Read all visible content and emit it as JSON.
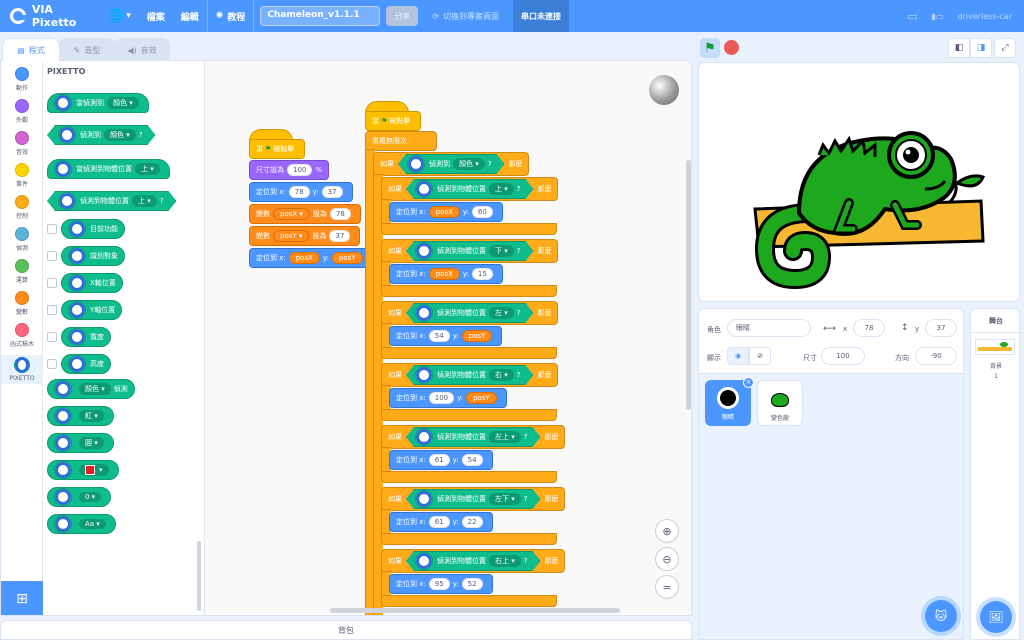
{
  "menubar": {
    "app_name": "VIA Pixetto",
    "file": "檔案",
    "edit": "編輯",
    "tutorials": "教程",
    "project_title": "Chameleon_v1.1.1",
    "share": "分享",
    "switch_page": "切換到專案頁面",
    "serial_status": "串口未連接",
    "device": "driverless-car"
  },
  "tabs": {
    "code": "程式",
    "costumes": "造型",
    "sounds": "音效"
  },
  "categories": [
    {
      "label": "動作",
      "color": "#4c97ff"
    },
    {
      "label": "外觀",
      "color": "#9966ff"
    },
    {
      "label": "音效",
      "color": "#cf63cf"
    },
    {
      "label": "事件",
      "color": "#ffd500"
    },
    {
      "label": "控制",
      "color": "#ffab19"
    },
    {
      "label": "偵測",
      "color": "#5cb1d6"
    },
    {
      "label": "運算",
      "color": "#59c059"
    },
    {
      "label": "變數",
      "color": "#ff8c1a"
    },
    {
      "label": "函式積木",
      "color": "#ff6680"
    },
    {
      "label": "PIXETTO",
      "color": "#ffffff"
    }
  ],
  "palette": {
    "title": "PIXETTO",
    "blocks": [
      {
        "text": "當偵測到",
        "dd": "顏色"
      },
      {
        "text": "偵測到",
        "dd": "顏色",
        "q": "?"
      },
      {
        "text": "當偵測到物體位置",
        "dd": "上"
      },
      {
        "text": "偵測到物體位置",
        "dd": "上",
        "q": "?"
      },
      {
        "text": "目前功能"
      },
      {
        "text": "識別對象"
      },
      {
        "text": "X軸位置"
      },
      {
        "text": "Y軸位置"
      },
      {
        "text": "寬度"
      },
      {
        "text": "高度"
      },
      {
        "dd": "顏色",
        "text": "偵測"
      },
      {
        "dd": "紅"
      },
      {
        "dd": "圓"
      },
      {
        "dd": ""
      },
      {
        "dd": "0"
      },
      {
        "dd": "Aa"
      }
    ]
  },
  "script1": {
    "hat": "當",
    "hat2": "被點擊",
    "size_label": "尺寸設為",
    "size_val": "100",
    "size_unit": "%",
    "goto_label": "定位到 x:",
    "goto_x": "78",
    "y_label": "y:",
    "goto_y": "37",
    "var_label": "變數",
    "set_to": "設為",
    "posx": "posX",
    "posx_val": "78",
    "posy": "posY",
    "posy_val": "37",
    "goto2_label": "定位到 x:",
    "goto2_x": "posX",
    "goto2_y": "posY"
  },
  "script2": {
    "hat": "當",
    "hat2": "被點擊",
    "forever": "重複無限次",
    "if_label": "如果",
    "then": "那麼",
    "detect_color": "偵測到",
    "color_dd": "顏色",
    "q": "?",
    "detect_pos": "偵測到物體位置",
    "goto_label": "定位到 x:",
    "y_label": "y:",
    "rows": [
      {
        "dir": "上",
        "x": "posX",
        "y": "60",
        "xv": true,
        "yv": false
      },
      {
        "dir": "下",
        "x": "posX",
        "y": "15",
        "xv": true,
        "yv": false
      },
      {
        "dir": "左",
        "x": "54",
        "y": "posY",
        "xv": false,
        "yv": true
      },
      {
        "dir": "右",
        "x": "100",
        "y": "posY",
        "xv": false,
        "yv": true
      },
      {
        "dir": "左上",
        "x": "61",
        "y": "54",
        "xv": false,
        "yv": false
      },
      {
        "dir": "左下",
        "x": "61",
        "y": "22",
        "xv": false,
        "yv": false
      },
      {
        "dir": "右上",
        "x": "95",
        "y": "52",
        "xv": false,
        "yv": false
      }
    ]
  },
  "backpack": "背包",
  "sprite_info": {
    "sprite_label": "角色",
    "sprite_name": "眼睛",
    "x_label": "x",
    "x_val": "78",
    "y_label": "y",
    "y_val": "37",
    "show_label": "顯示",
    "size_label": "尺寸",
    "size_val": "100",
    "dir_label": "方向",
    "dir_val": "-90"
  },
  "sprites": [
    {
      "name": "眼睛",
      "selected": true
    },
    {
      "name": "變色龍",
      "selected": false
    }
  ],
  "stage_pane": {
    "title": "舞台",
    "backdrop_label": "背景",
    "backdrop_count": "1"
  }
}
